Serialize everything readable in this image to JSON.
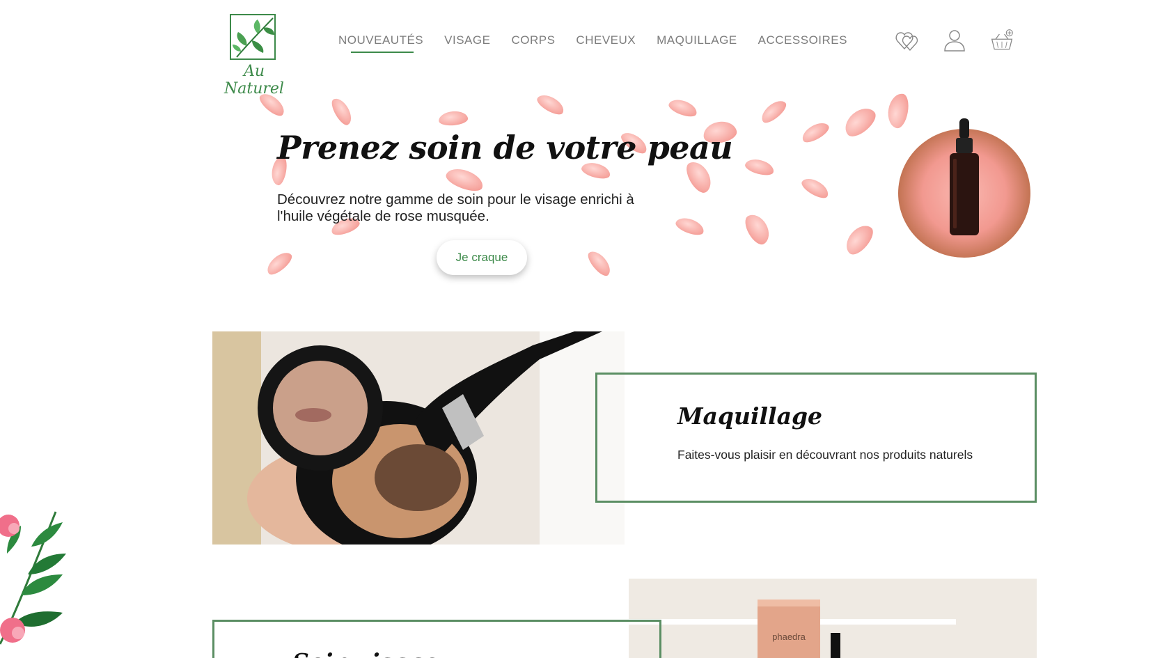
{
  "brand": {
    "logo_text": "Au Naturel"
  },
  "nav": {
    "items": [
      {
        "label": "NOUVEAUTÉS",
        "active": true
      },
      {
        "label": "VISAGE"
      },
      {
        "label": "CORPS"
      },
      {
        "label": "CHEVEUX"
      },
      {
        "label": "MAQUILLAGE"
      },
      {
        "label": "ACCESSOIRES"
      }
    ]
  },
  "header_icons": [
    "hearts-icon",
    "user-icon",
    "basket-icon"
  ],
  "hero": {
    "title": "Prenez soin de votre peau",
    "subtitle": "Découvrez notre gamme de soin pour le visage enrichi à l'huile végétale de rose musquée.",
    "button_label": "Je craque"
  },
  "categories": [
    {
      "title": "Maquillage",
      "description": "Faites-vous plaisir en découvrant nos produits naturels"
    },
    {
      "title": "Soin visage",
      "product_label": "phaedra"
    }
  ],
  "colors": {
    "accent": "#3d8a4a",
    "card_border": "#5b8e63",
    "nav_text": "#7d7d7d",
    "petal": "#f59a93"
  }
}
